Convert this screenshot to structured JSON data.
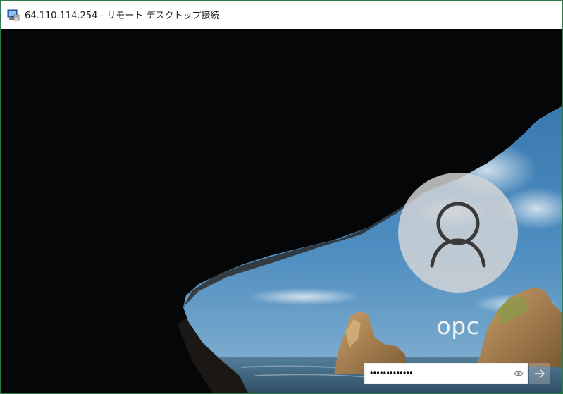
{
  "window": {
    "title": "64.110.114.254 - リモート デスクトップ接続",
    "icon": "remote-desktop-icon"
  },
  "login": {
    "username": "opc",
    "password_masked": "•••••••••••••",
    "avatar_icon": "user-icon",
    "reveal_icon": "eye-icon",
    "submit_icon": "arrow-right-icon"
  },
  "colors": {
    "sky": "#3f7fb3",
    "sea": "#6d8fa8",
    "rock": "#b08a58",
    "avatar_bg": "#d7d7d7",
    "text_light": "#f2f2f2"
  }
}
